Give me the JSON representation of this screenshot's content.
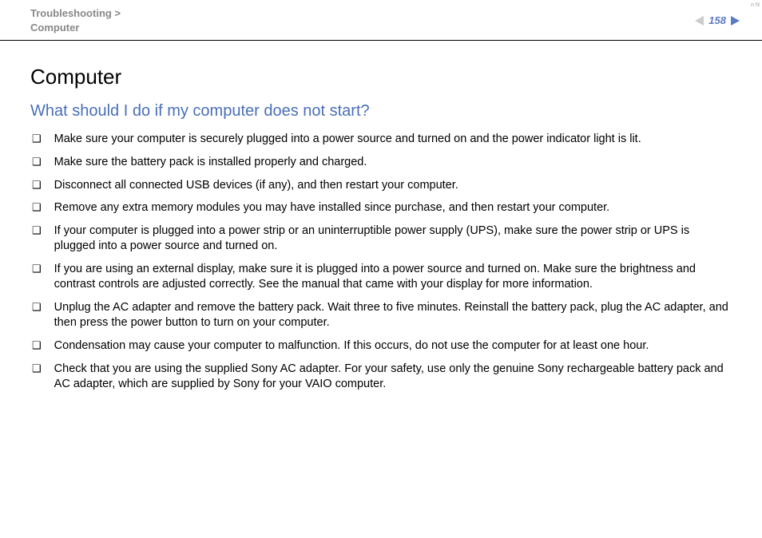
{
  "header": {
    "breadcrumb_line1": "Troubleshooting >",
    "breadcrumb_line2": "Computer",
    "page_number": "158",
    "corner_mark": "n N"
  },
  "content": {
    "section_title": "Computer",
    "question": "What should I do if my computer does not start?",
    "bullets": [
      "Make sure your computer is securely plugged into a power source and turned on and the power indicator light is lit.",
      "Make sure the battery pack is installed properly and charged.",
      "Disconnect all connected USB devices (if any), and then restart your computer.",
      "Remove any extra memory modules you may have installed since purchase, and then restart your computer.",
      "If your computer is plugged into a power strip or an uninterruptible power supply (UPS), make sure the power strip or UPS is plugged into a power source and turned on.",
      "If you are using an external display, make sure it is plugged into a power source and turned on. Make sure the brightness and contrast controls are adjusted correctly. See the manual that came with your display for more information.",
      "Unplug the AC adapter and remove the battery pack. Wait three to five minutes. Reinstall the battery pack, plug the AC adapter, and then press the power button to turn on your computer.",
      "Condensation may cause your computer to malfunction. If this occurs, do not use the computer for at least one hour.",
      "Check that you are using the supplied Sony AC adapter. For your safety, use only the genuine Sony rechargeable battery pack and AC adapter, which are supplied by Sony for your VAIO computer."
    ]
  }
}
